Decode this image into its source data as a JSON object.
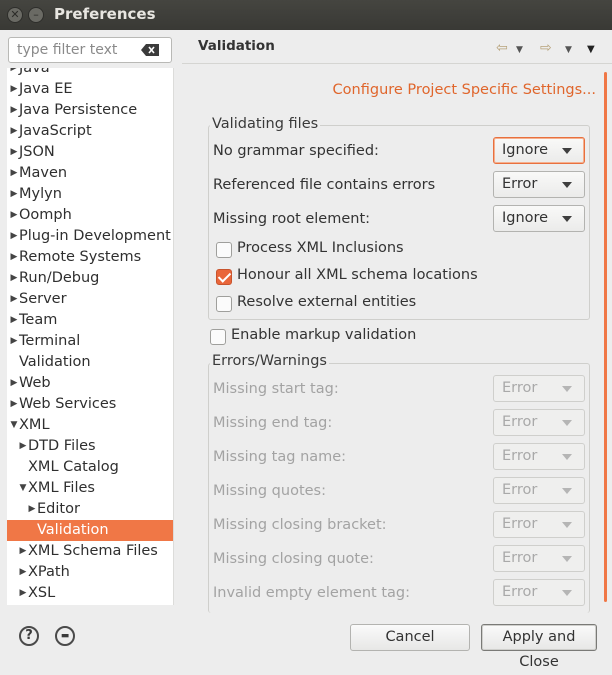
{
  "window": {
    "title": "Preferences"
  },
  "filter": {
    "placeholder": "type filter text"
  },
  "tree": [
    {
      "label": "Java",
      "level": 0,
      "expander": "collapsed"
    },
    {
      "label": "Java EE",
      "level": 0,
      "expander": "collapsed"
    },
    {
      "label": "Java Persistence",
      "level": 0,
      "expander": "collapsed"
    },
    {
      "label": "JavaScript",
      "level": 0,
      "expander": "collapsed"
    },
    {
      "label": "JSON",
      "level": 0,
      "expander": "collapsed"
    },
    {
      "label": "Maven",
      "level": 0,
      "expander": "collapsed"
    },
    {
      "label": "Mylyn",
      "level": 0,
      "expander": "collapsed"
    },
    {
      "label": "Oomph",
      "level": 0,
      "expander": "collapsed"
    },
    {
      "label": "Plug-in Development",
      "level": 0,
      "expander": "collapsed"
    },
    {
      "label": "Remote Systems",
      "level": 0,
      "expander": "collapsed"
    },
    {
      "label": "Run/Debug",
      "level": 0,
      "expander": "collapsed"
    },
    {
      "label": "Server",
      "level": 0,
      "expander": "collapsed"
    },
    {
      "label": "Team",
      "level": 0,
      "expander": "collapsed"
    },
    {
      "label": "Terminal",
      "level": 0,
      "expander": "collapsed"
    },
    {
      "label": "Validation",
      "level": 0,
      "expander": "none"
    },
    {
      "label": "Web",
      "level": 0,
      "expander": "collapsed"
    },
    {
      "label": "Web Services",
      "level": 0,
      "expander": "collapsed"
    },
    {
      "label": "XML",
      "level": 0,
      "expander": "expanded"
    },
    {
      "label": "DTD Files",
      "level": 1,
      "expander": "collapsed"
    },
    {
      "label": "XML Catalog",
      "level": 1,
      "expander": "none"
    },
    {
      "label": "XML Files",
      "level": 1,
      "expander": "expanded"
    },
    {
      "label": "Editor",
      "level": 2,
      "expander": "collapsed"
    },
    {
      "label": "Validation",
      "level": 2,
      "expander": "none",
      "selected": true
    },
    {
      "label": "XML Schema Files",
      "level": 1,
      "expander": "collapsed"
    },
    {
      "label": "XPath",
      "level": 1,
      "expander": "collapsed"
    },
    {
      "label": "XSL",
      "level": 1,
      "expander": "collapsed"
    }
  ],
  "page": {
    "title": "Validation",
    "config_link": "Configure Project Specific Settings...",
    "validating_files": {
      "title": "Validating files",
      "rows": [
        {
          "label": "No grammar specified:",
          "value": "Ignore"
        },
        {
          "label": "Referenced file contains errors",
          "value": "Error"
        },
        {
          "label": "Missing root element:",
          "value": "Ignore"
        }
      ],
      "checks": [
        {
          "label": "Process XML Inclusions",
          "checked": false
        },
        {
          "label": "Honour all XML schema locations",
          "checked": true
        },
        {
          "label": "Resolve external entities",
          "checked": false
        }
      ]
    },
    "markup": {
      "label": "Enable markup validation",
      "checked": false
    },
    "errors_warnings": {
      "title": "Errors/Warnings",
      "rows": [
        {
          "label": "Missing start tag:",
          "value": "Error"
        },
        {
          "label": "Missing end tag:",
          "value": "Error"
        },
        {
          "label": "Missing tag name:",
          "value": "Error"
        },
        {
          "label": "Missing quotes:",
          "value": "Error"
        },
        {
          "label": "Missing closing bracket:",
          "value": "Error"
        },
        {
          "label": "Missing closing quote:",
          "value": "Error"
        },
        {
          "label": "Invalid empty element tag:",
          "value": "Error"
        }
      ]
    }
  },
  "buttons": {
    "cancel": "Cancel",
    "apply_close": "Apply and Close"
  },
  "colors": {
    "accent": "#f07746",
    "link": "#e0662c",
    "titlebar": "#3f3f3b"
  }
}
